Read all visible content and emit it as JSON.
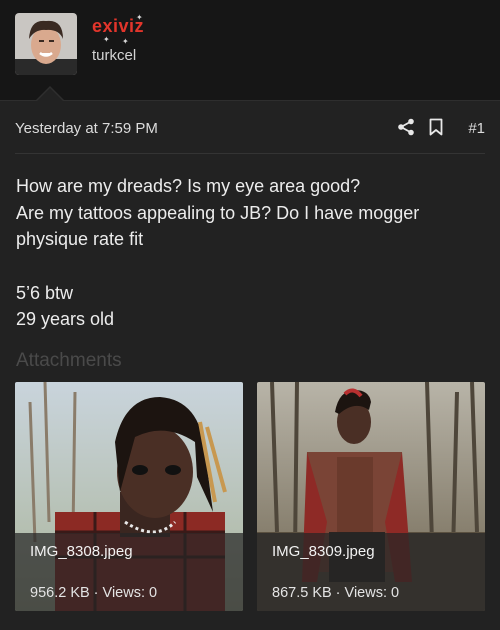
{
  "user": {
    "username": "exiviz",
    "title": "turkcel"
  },
  "post": {
    "timestamp": "Yesterday at 7:59 PM",
    "number": "#1",
    "lines": [
      "How are my dreads? Is my eye area good?",
      "Are my tattoos appealing to JB? Do I have mogger",
      "physique rate fit",
      "5’6 btw",
      "29 years old"
    ]
  },
  "attachments": {
    "label": "Attachments",
    "items": [
      {
        "filename": "IMG_8308.jpeg",
        "meta": "956.2 KB · Views: 0"
      },
      {
        "filename": "IMG_8309.jpeg",
        "meta": "867.5 KB · Views: 0"
      }
    ]
  },
  "colors": {
    "background": "#161616",
    "message_bg": "#222222",
    "username": "#e2352b"
  },
  "icons": [
    "share-icon",
    "bookmark-icon"
  ]
}
